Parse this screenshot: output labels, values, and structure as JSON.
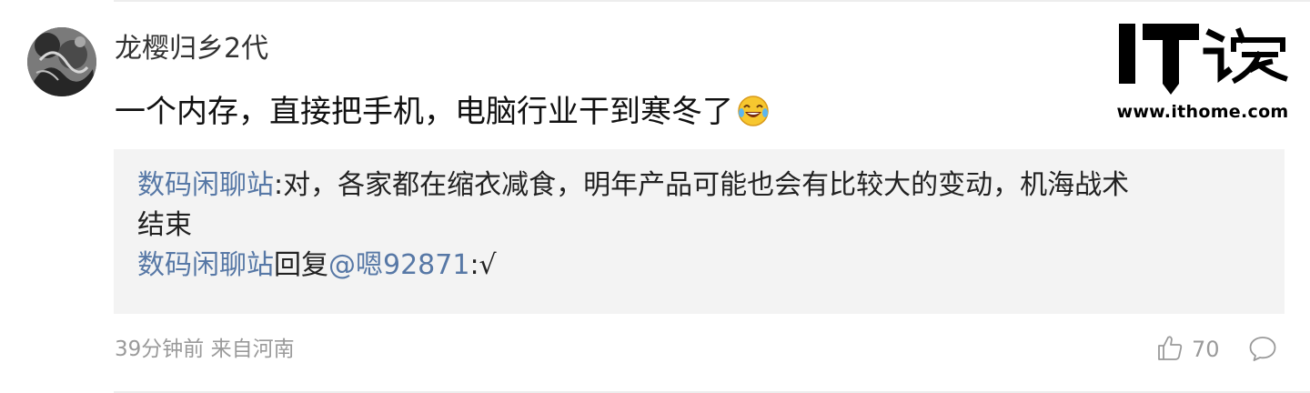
{
  "comment": {
    "username": "龙樱归乡2代",
    "text": "一个内存，直接把手机，电脑行业干到寒冬了",
    "emoji": "laughing-crying-emoji"
  },
  "quote": {
    "author": "数码闲聊站",
    "colon": ":",
    "text_line1": "对，各家都在缩衣减食，明年产品可能也会有比较大的变动，机海战术",
    "text_line2": "结束",
    "reply_author": "数码闲聊站",
    "reply_word": "回复",
    "reply_target": "@嗯92871",
    "reply_colon": ":",
    "reply_text": "√"
  },
  "meta": {
    "time": "39分钟前",
    "location": "来自河南"
  },
  "actions": {
    "like_count": "70"
  },
  "logo": {
    "site": "www.ithome.com"
  },
  "colors": {
    "link": "#5778a6",
    "quote_bg": "#f3f3f3",
    "meta_text": "#9a9a9a"
  }
}
